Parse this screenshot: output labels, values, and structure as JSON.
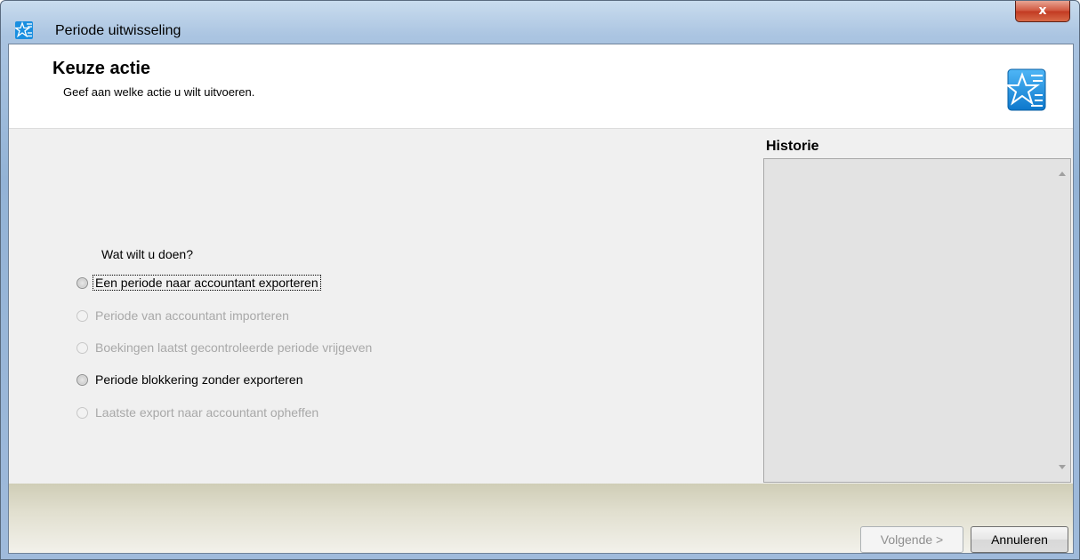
{
  "window": {
    "title": "Periode uitwisseling",
    "close_label": "x"
  },
  "header": {
    "title": "Keuze actie",
    "subtitle": "Geef aan welke actie u wilt uitvoeren."
  },
  "main": {
    "question": "Wat wilt u doen?",
    "options": [
      {
        "label": "Een periode naar accountant exporteren",
        "enabled": true,
        "focused": true
      },
      {
        "label": "Periode van accountant importeren",
        "enabled": false
      },
      {
        "label": "Boekingen laatst gecontroleerde periode vrijgeven",
        "enabled": false
      },
      {
        "label": "Periode blokkering zonder exporteren",
        "enabled": true
      },
      {
        "label": "Laatste export naar accountant opheffen",
        "enabled": false
      }
    ]
  },
  "history": {
    "label": "Historie"
  },
  "footer": {
    "next_label": "Volgende >",
    "cancel_label": "Annuleren"
  },
  "colors": {
    "accent": "#1a8fe0",
    "disabled_text": "#a8a8a8"
  }
}
